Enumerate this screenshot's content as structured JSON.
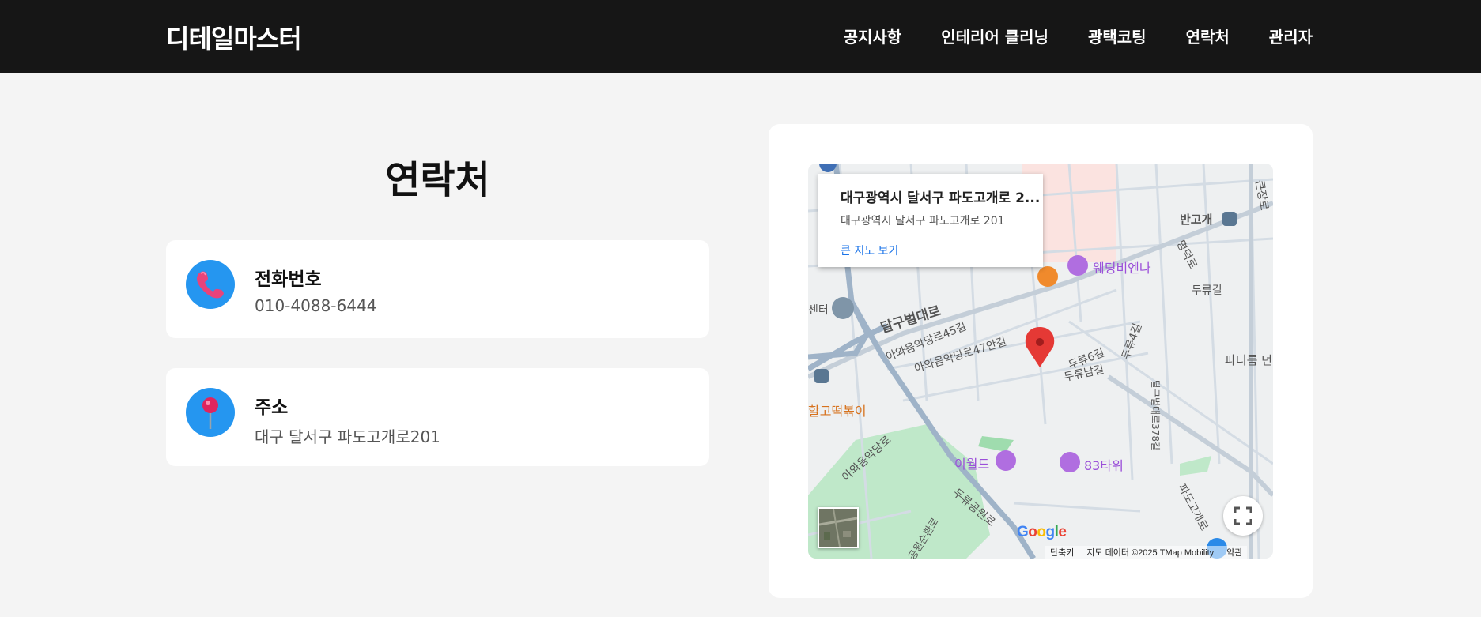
{
  "header": {
    "logo": "디테일마스터",
    "nav": [
      "공지사항",
      "인테리어 클리닝",
      "광택코팅",
      "연락처",
      "관리자"
    ]
  },
  "page": {
    "title": "연락처"
  },
  "contacts": [
    {
      "icon": "phone-icon",
      "label": "전화번호",
      "value": "010-4088-6444"
    },
    {
      "icon": "pin-icon",
      "label": "주소",
      "value": "대구 달서구 파도고개로201"
    }
  ],
  "map": {
    "info_window": {
      "title": "대구광역시 달서구 파도고개로 2...",
      "address": "대구광역시 달서구 파도고개로 201",
      "link": "큰 지도 보기"
    },
    "labels": {
      "street_1": "달구벌대로",
      "street_2": "아와음악당로45길",
      "street_3": "아와음악당로47안길",
      "street_4": "아와음악당로",
      "street_5": "두류공원로",
      "street_6": "파도고개로",
      "street_7": "두류남길",
      "street_8": "두류6길",
      "street_9": "두류4길",
      "street_10": "명덕로",
      "street_11": "두류길",
      "street_12": "반고개",
      "street_13": "큰장로",
      "street_14": "달구벌대로378길",
      "street_15": "파티룸 던",
      "street_16": "공원순환로",
      "street_17": "센터",
      "poi_1": "웨딩비엔나",
      "poi_2": "이월드",
      "poi_3": "83타워",
      "poi_4": "할고떡볶이"
    },
    "google_logo": "Google",
    "attribution": {
      "shortcuts": "단축키",
      "data": "지도 데이터 ©2025 TMap Mobility",
      "terms": "약관"
    },
    "colors": {
      "marker": "#e53935",
      "poi": "#9b4fd9",
      "park": "#bfe8c9",
      "road": "#9fb3c8"
    }
  }
}
